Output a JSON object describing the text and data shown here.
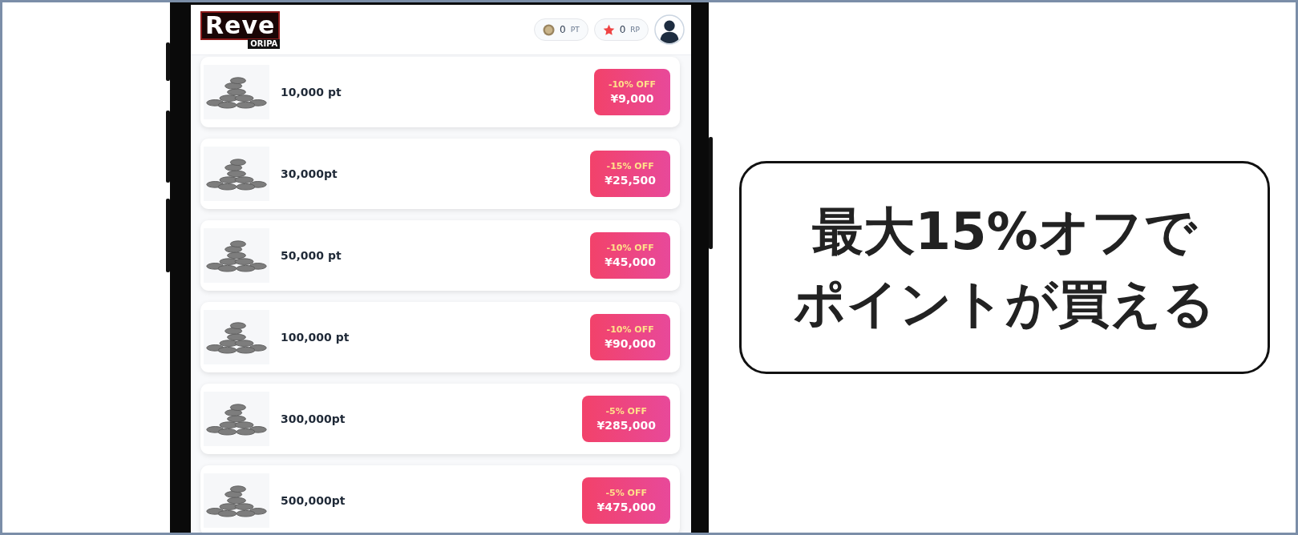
{
  "header": {
    "logo_title": "Reve",
    "logo_subtitle": "ORIPA",
    "balances": [
      {
        "kind": "coin",
        "value": "0",
        "unit": "PT"
      },
      {
        "kind": "star",
        "value": "0",
        "unit": "RP"
      }
    ]
  },
  "packages": [
    {
      "points": "10,000 pt",
      "discount": "-10% OFF",
      "price": "¥9,000"
    },
    {
      "points": "30,000pt",
      "discount": "-15% OFF",
      "price": "¥25,500"
    },
    {
      "points": "50,000 pt",
      "discount": "-10% OFF",
      "price": "¥45,000"
    },
    {
      "points": "100,000 pt",
      "discount": "-10% OFF",
      "price": "¥90,000"
    },
    {
      "points": "300,000pt",
      "discount": "-5% OFF",
      "price": "¥285,000"
    },
    {
      "points": "500,000pt",
      "discount": "-5% OFF",
      "price": "¥475,000"
    }
  ],
  "callout": {
    "lines": [
      "最大15%オフで",
      "ポイントが買える"
    ]
  }
}
